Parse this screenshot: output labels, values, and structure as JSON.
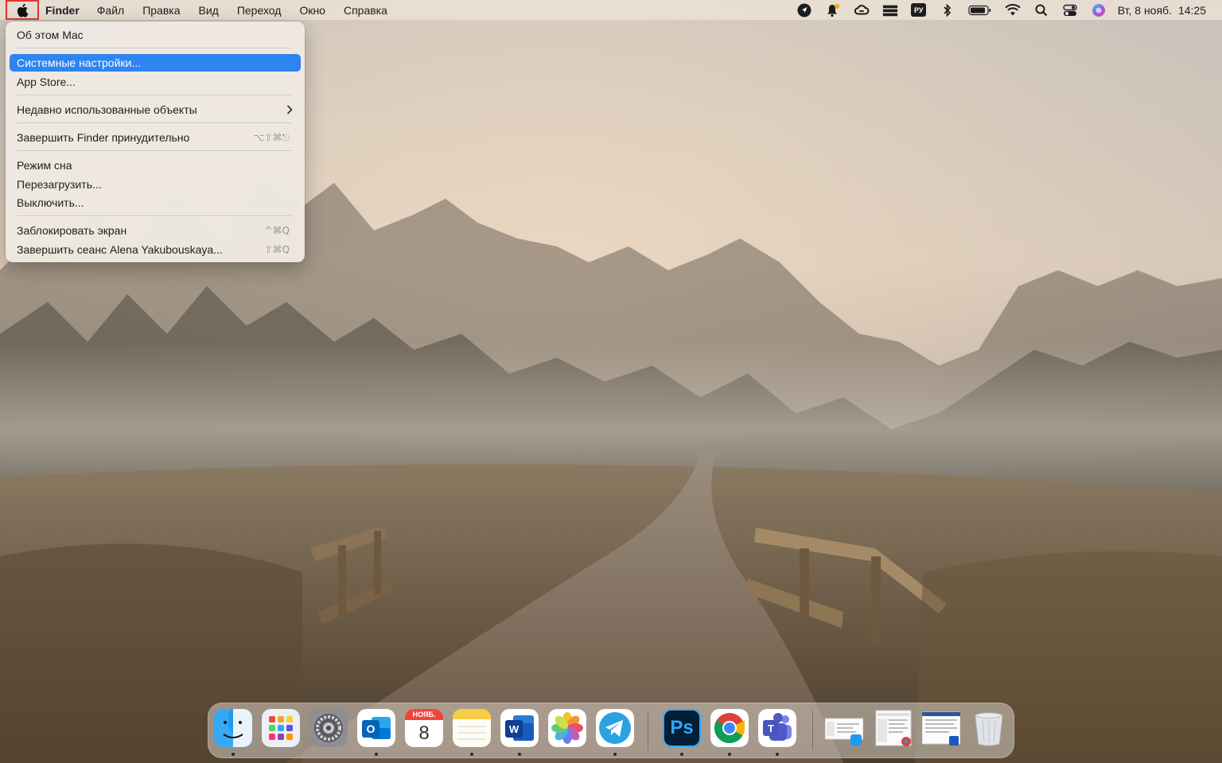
{
  "menubar": {
    "apple_icon": "apple-logo-icon",
    "app_name": "Finder",
    "menus": [
      "Файл",
      "Правка",
      "Вид",
      "Переход",
      "Окно",
      "Справка"
    ],
    "status_icons": [
      "location-arrow-icon",
      "notification-bell-icon",
      "creative-cloud-icon",
      "stack-icon",
      "input-language-icon",
      "bluetooth-icon",
      "battery-icon",
      "wifi-icon",
      "spotlight-search-icon",
      "control-center-icon",
      "siri-icon"
    ],
    "input_language": "РУ",
    "date": "Вт, 8 нояб.",
    "time": "14:25"
  },
  "apple_menu": {
    "about": "Об этом Mac",
    "system_settings": "Системные настройки...",
    "app_store": "App Store...",
    "recent_items": "Недавно использованные объекты",
    "force_quit": "Завершить Finder принудительно",
    "force_quit_shortcut": "⌥⇧⌘⎋",
    "sleep": "Режим сна",
    "restart": "Перезагрузить...",
    "shutdown": "Выключить...",
    "lock_screen": "Заблокировать экран",
    "lock_screen_shortcut": "^⌘Q",
    "log_out": "Завершить сеанс Alena Yakubouskaya...",
    "log_out_shortcut": "⇧⌘Q",
    "selected_item": "system_settings"
  },
  "dock": {
    "calendar_month": "НОЯБ.",
    "calendar_day": "8",
    "photoshop_label": "Ps",
    "word_label": "W",
    "outlook_label": "O",
    "teams_label": "T",
    "apps": [
      "Finder",
      "Launchpad",
      "System Settings",
      "Outlook",
      "Calendar",
      "Notes",
      "Word",
      "Photos",
      "Telegram",
      "Photoshop",
      "Chrome",
      "Teams"
    ],
    "recent": [
      "Finder window",
      "Chrome window",
      "Word document"
    ],
    "trash": "Trash"
  },
  "colors": {
    "selection": "#2e84f0",
    "highlight_box": "#e0352b"
  }
}
